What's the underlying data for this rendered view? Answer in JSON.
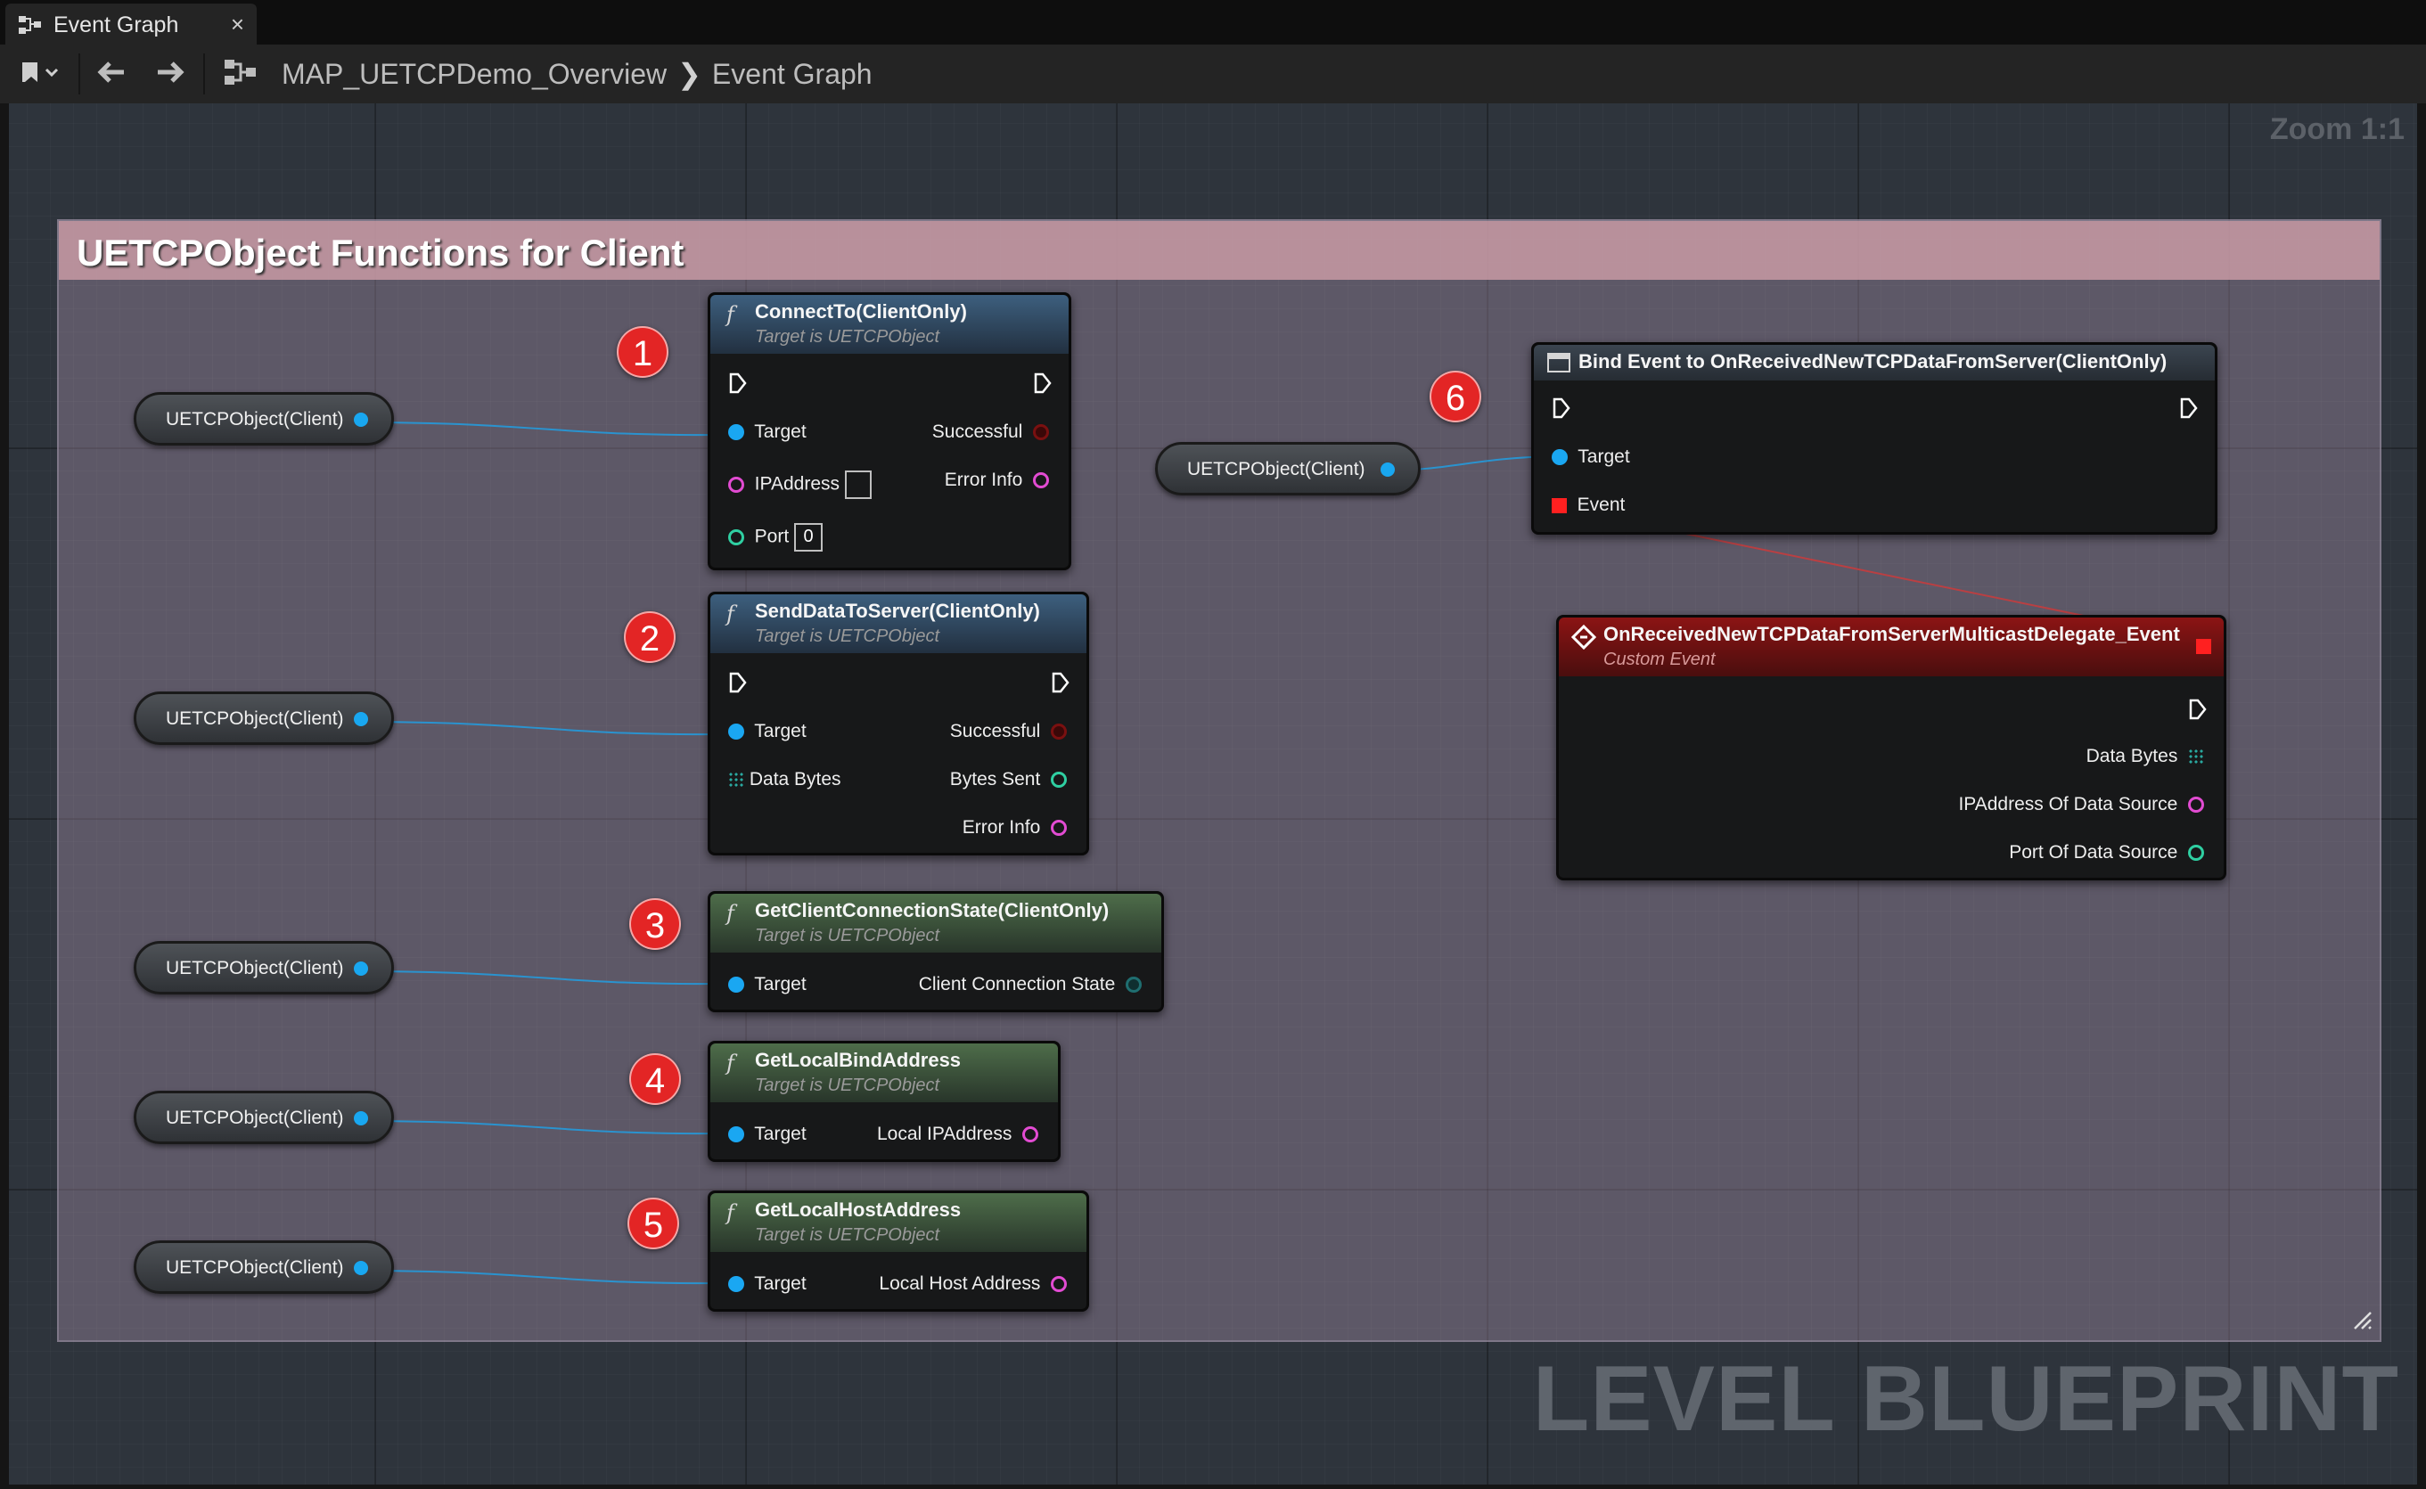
{
  "tab": {
    "label": "Event Graph",
    "close": "×"
  },
  "toolbar": {
    "breadcrumb": [
      "MAP_UETCPDemo_Overview",
      "Event Graph"
    ],
    "zoom": "Zoom 1:1"
  },
  "graph": {
    "watermark": "LEVEL BLUEPRINT",
    "comment_title": "UETCPObject Functions for Client",
    "variable_label": "UETCPObject(Client)",
    "nodes": {
      "connect": {
        "title": "ConnectTo(ClientOnly)",
        "subtitle": "Target is UETCPObject",
        "target": "Target",
        "ip": "IPAddress",
        "port": "Port",
        "port_value": "0",
        "successful": "Successful",
        "error": "Error Info"
      },
      "send": {
        "title": "SendDataToServer(ClientOnly)",
        "subtitle": "Target is UETCPObject",
        "target": "Target",
        "data": "Data Bytes",
        "successful": "Successful",
        "bytes_sent": "Bytes Sent",
        "error": "Error Info"
      },
      "state": {
        "title": "GetClientConnectionState(ClientOnly)",
        "subtitle": "Target is UETCPObject",
        "target": "Target",
        "out": "Client Connection State"
      },
      "bind_addr": {
        "title": "GetLocalBindAddress",
        "subtitle": "Target is UETCPObject",
        "target": "Target",
        "out": "Local IPAddress"
      },
      "host_addr": {
        "title": "GetLocalHostAddress",
        "subtitle": "Target is UETCPObject",
        "target": "Target",
        "out": "Local Host Address"
      },
      "bind_event": {
        "title": "Bind Event to OnReceivedNewTCPDataFromServer(ClientOnly)",
        "target": "Target",
        "event": "Event"
      },
      "custom_event": {
        "title": "OnReceivedNewTCPDataFromServerMulticastDelegate_Event",
        "subtitle": "Custom Event",
        "data": "Data Bytes",
        "ip": "IPAddress Of Data Source",
        "port": "Port Of Data Source"
      }
    },
    "badges": [
      "1",
      "2",
      "3",
      "4",
      "5",
      "6"
    ]
  },
  "colors": {
    "object_pin": "#1aa7f2",
    "string_pin": "#e24bd2",
    "int_pin": "#2fcfa2",
    "event_pin": "#ff2020",
    "comment_header": "#c89aa4",
    "badge": "#e32525"
  },
  "icons": [
    "blueprint-graph-icon",
    "bookmark-icon",
    "back-arrow-icon",
    "forward-arrow-icon",
    "function-icon",
    "delegate-icon",
    "event-icon",
    "resize-grip-icon"
  ]
}
